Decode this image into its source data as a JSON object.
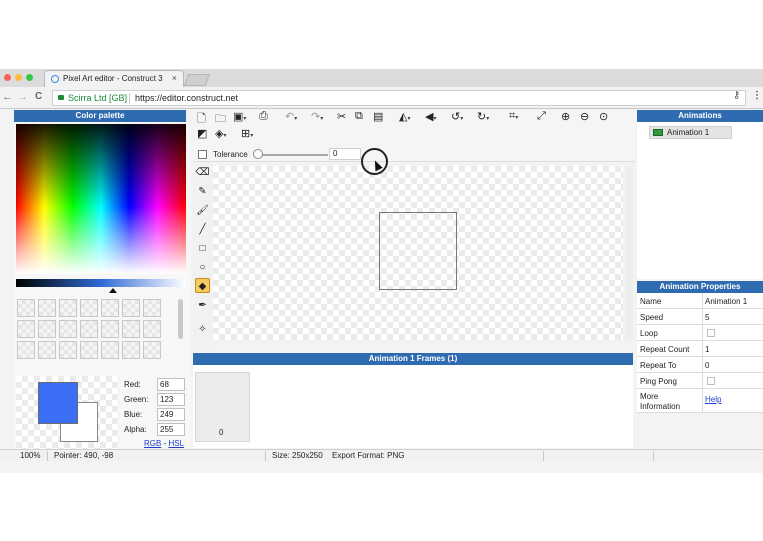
{
  "browser": {
    "tab_title": "Pixel Art editor - Construct 3",
    "tab_close": "×",
    "security_label": "Scirra Ltd [GB]",
    "url": "https://editor.construct.net",
    "back": "←",
    "forward": "→",
    "reload": "C",
    "key_icon": "key-icon",
    "menu_icon": "menu-dots-icon"
  },
  "palette": {
    "title": "Color palette",
    "fields": [
      {
        "label": "Red:",
        "value": "68"
      },
      {
        "label": "Green:",
        "value": "123"
      },
      {
        "label": "Blue:",
        "value": "249"
      },
      {
        "label": "Alpha:",
        "value": "255"
      }
    ],
    "mode_rgb": "RGB",
    "mode_sep": " - ",
    "mode_hsl": "HSL",
    "primary_color": "#3b6ff6"
  },
  "toolbar": {
    "tolerance_label": "Tolerance",
    "tolerance_value": "0"
  },
  "frames": {
    "title": "Animation 1 Frames (1)",
    "frame_number": "0"
  },
  "animations": {
    "title": "Animations",
    "items": [
      "Animation 1"
    ]
  },
  "properties": {
    "title": "Animation Properties",
    "rows": [
      {
        "name": "Name",
        "value": "Animation 1",
        "type": "text"
      },
      {
        "name": "Speed",
        "value": "5",
        "type": "text"
      },
      {
        "name": "Loop",
        "value": "",
        "type": "check"
      },
      {
        "name": "Repeat Count",
        "value": "1",
        "type": "text"
      },
      {
        "name": "Repeat To",
        "value": "0",
        "type": "text"
      },
      {
        "name": "Ping Pong",
        "value": "",
        "type": "check"
      },
      {
        "name": "More Information",
        "value": "Help",
        "type": "link"
      }
    ]
  },
  "status": {
    "zoom": "100%",
    "pointer": "Pointer: 490, -98",
    "size": "Size: 250x250",
    "export": "Export Format: PNG"
  },
  "colors": {
    "accent": "#2f6bb0",
    "active_tool": "#f7ca61"
  }
}
